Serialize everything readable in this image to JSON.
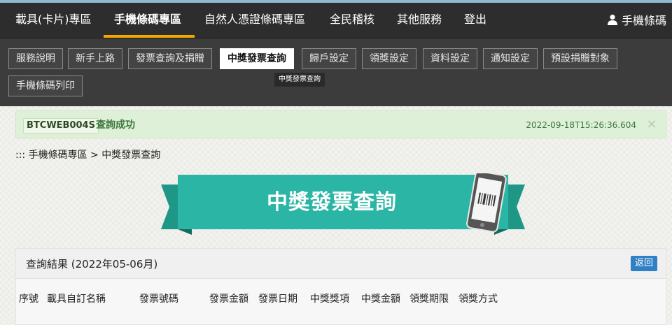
{
  "topnav": {
    "items": [
      {
        "label": "載具(卡片)專區",
        "active": false
      },
      {
        "label": "手機條碼專區",
        "active": true
      },
      {
        "label": "自然人憑證條碼專區",
        "active": false
      },
      {
        "label": "全民稽核",
        "active": false
      },
      {
        "label": "其他服務",
        "active": false
      },
      {
        "label": "登出",
        "active": false
      }
    ],
    "user_label": "手機條碼",
    "user_icon": "user-icon",
    "accent_color": "#f0a500"
  },
  "subnav": {
    "tabs": [
      {
        "label": "服務說明",
        "active": false
      },
      {
        "label": "新手上路",
        "active": false
      },
      {
        "label": "發票查詢及捐贈",
        "active": false
      },
      {
        "label": "中獎發票查詢",
        "active": true
      },
      {
        "label": "歸戶設定",
        "active": false
      },
      {
        "label": "領獎設定",
        "active": false
      },
      {
        "label": "資料設定",
        "active": false
      },
      {
        "label": "通知設定",
        "active": false
      },
      {
        "label": "預設捐贈對象",
        "active": false
      },
      {
        "label": "手機條碼列印",
        "active": false
      }
    ],
    "tooltip": "中獎發票查詢"
  },
  "alert": {
    "code": "BTCWEB004S",
    "message": "查詢成功",
    "timestamp": "2022-09-18T15:26:36.604",
    "close_symbol": "×",
    "color": "#dff0d8"
  },
  "breadcrumb": {
    "text": "::: 手機條碼專區 > 中獎發票查詢"
  },
  "banner": {
    "title": "中獎發票查詢",
    "color": "#2bb5a4",
    "icon": "phone-barcode-icon"
  },
  "results": {
    "title": "查詢結果 (2022年05-06月)",
    "back_label": "返回",
    "columns": [
      "序號",
      "載具自訂名稱",
      "發票號碼",
      "發票金額",
      "發票日期",
      "中獎獎項",
      "中獎金額",
      "領獎期限",
      "領獎方式"
    ]
  }
}
